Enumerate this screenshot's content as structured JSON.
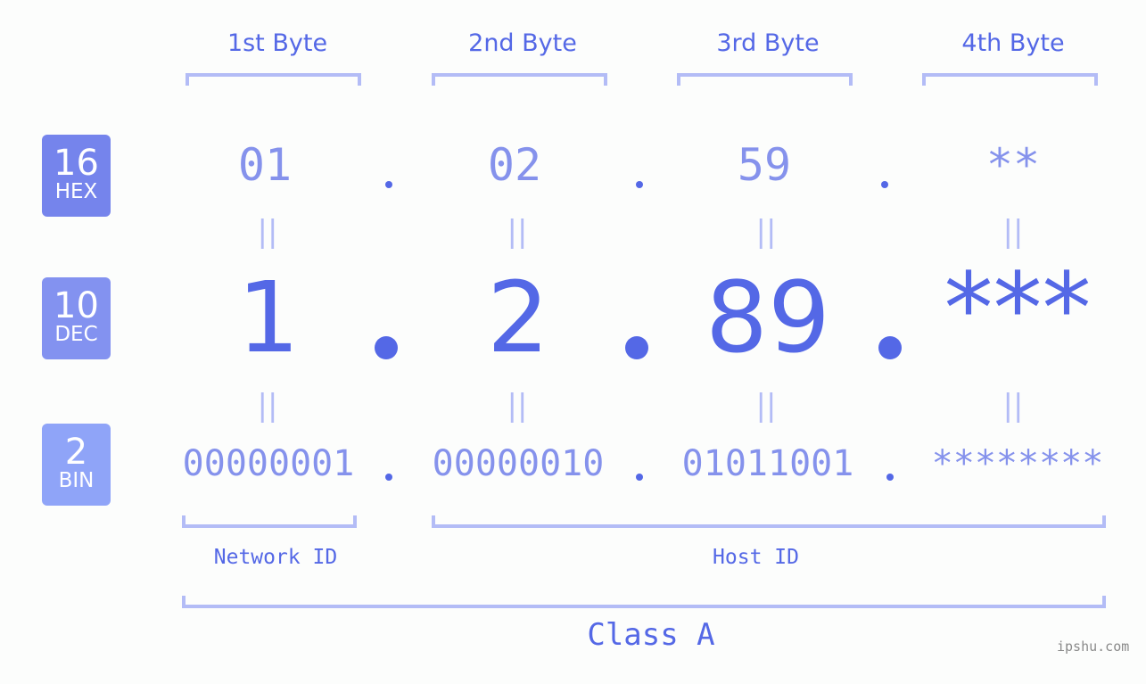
{
  "bytes": [
    {
      "label": "1st Byte",
      "hex": "01",
      "dec": "1",
      "bin": "00000001"
    },
    {
      "label": "2nd Byte",
      "hex": "02",
      "dec": "2",
      "bin": "00000010"
    },
    {
      "label": "3rd Byte",
      "hex": "59",
      "dec": "89",
      "bin": "01011001"
    },
    {
      "label": "4th Byte",
      "hex": "**",
      "dec": "***",
      "bin": "********"
    }
  ],
  "badges": {
    "hex": {
      "number": "16",
      "label": "HEX",
      "color": "#7584ec"
    },
    "dec": {
      "number": "10",
      "label": "DEC",
      "color": "#8392f0"
    },
    "bin": {
      "number": "2",
      "label": "BIN",
      "color": "#8fa4f8"
    }
  },
  "equals_symbol": "||",
  "network_id_label": "Network ID",
  "host_id_label": "Host ID",
  "class_label": "Class A",
  "site": "ipshu.com",
  "colors": {
    "primary": "#5468e6",
    "secondary": "#8592ec",
    "bracket": "#b3bcf6",
    "background": "#fcfdfc"
  }
}
